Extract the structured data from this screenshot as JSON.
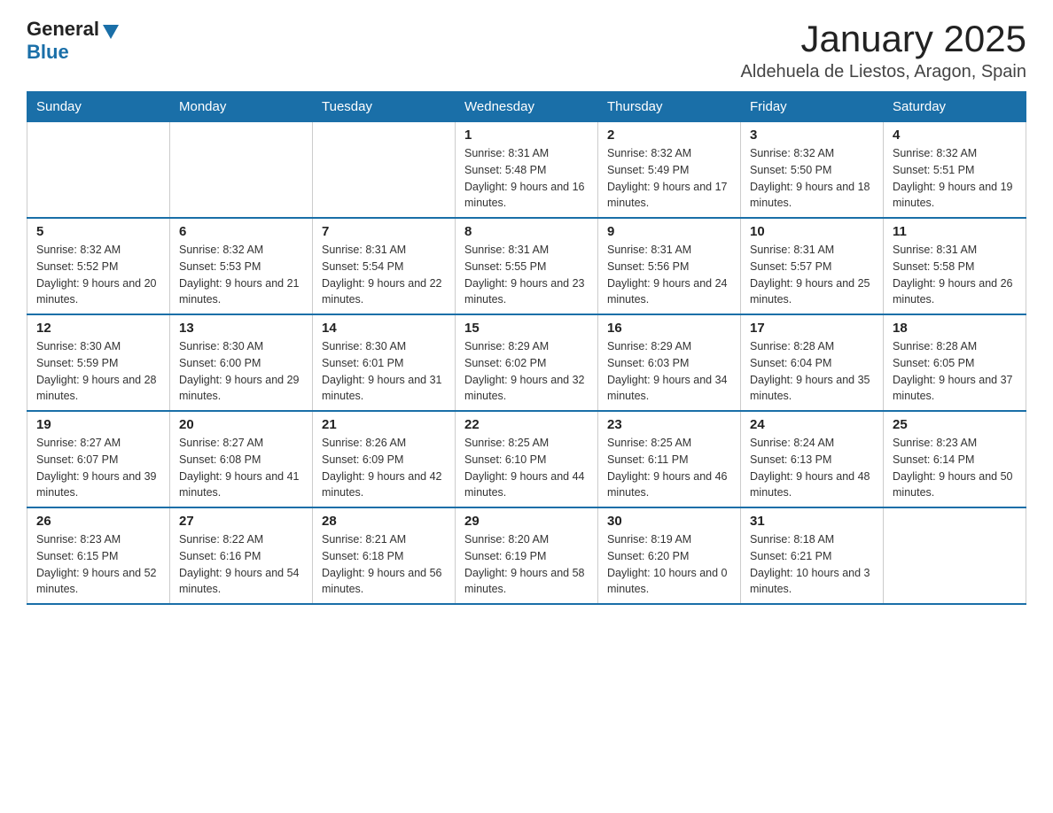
{
  "header": {
    "logo_general": "General",
    "logo_blue": "Blue",
    "month": "January 2025",
    "location": "Aldehuela de Liestos, Aragon, Spain"
  },
  "days_of_week": [
    "Sunday",
    "Monday",
    "Tuesday",
    "Wednesday",
    "Thursday",
    "Friday",
    "Saturday"
  ],
  "weeks": [
    [
      {
        "day": "",
        "info": ""
      },
      {
        "day": "",
        "info": ""
      },
      {
        "day": "",
        "info": ""
      },
      {
        "day": "1",
        "info": "Sunrise: 8:31 AM\nSunset: 5:48 PM\nDaylight: 9 hours and 16 minutes."
      },
      {
        "day": "2",
        "info": "Sunrise: 8:32 AM\nSunset: 5:49 PM\nDaylight: 9 hours and 17 minutes."
      },
      {
        "day": "3",
        "info": "Sunrise: 8:32 AM\nSunset: 5:50 PM\nDaylight: 9 hours and 18 minutes."
      },
      {
        "day": "4",
        "info": "Sunrise: 8:32 AM\nSunset: 5:51 PM\nDaylight: 9 hours and 19 minutes."
      }
    ],
    [
      {
        "day": "5",
        "info": "Sunrise: 8:32 AM\nSunset: 5:52 PM\nDaylight: 9 hours and 20 minutes."
      },
      {
        "day": "6",
        "info": "Sunrise: 8:32 AM\nSunset: 5:53 PM\nDaylight: 9 hours and 21 minutes."
      },
      {
        "day": "7",
        "info": "Sunrise: 8:31 AM\nSunset: 5:54 PM\nDaylight: 9 hours and 22 minutes."
      },
      {
        "day": "8",
        "info": "Sunrise: 8:31 AM\nSunset: 5:55 PM\nDaylight: 9 hours and 23 minutes."
      },
      {
        "day": "9",
        "info": "Sunrise: 8:31 AM\nSunset: 5:56 PM\nDaylight: 9 hours and 24 minutes."
      },
      {
        "day": "10",
        "info": "Sunrise: 8:31 AM\nSunset: 5:57 PM\nDaylight: 9 hours and 25 minutes."
      },
      {
        "day": "11",
        "info": "Sunrise: 8:31 AM\nSunset: 5:58 PM\nDaylight: 9 hours and 26 minutes."
      }
    ],
    [
      {
        "day": "12",
        "info": "Sunrise: 8:30 AM\nSunset: 5:59 PM\nDaylight: 9 hours and 28 minutes."
      },
      {
        "day": "13",
        "info": "Sunrise: 8:30 AM\nSunset: 6:00 PM\nDaylight: 9 hours and 29 minutes."
      },
      {
        "day": "14",
        "info": "Sunrise: 8:30 AM\nSunset: 6:01 PM\nDaylight: 9 hours and 31 minutes."
      },
      {
        "day": "15",
        "info": "Sunrise: 8:29 AM\nSunset: 6:02 PM\nDaylight: 9 hours and 32 minutes."
      },
      {
        "day": "16",
        "info": "Sunrise: 8:29 AM\nSunset: 6:03 PM\nDaylight: 9 hours and 34 minutes."
      },
      {
        "day": "17",
        "info": "Sunrise: 8:28 AM\nSunset: 6:04 PM\nDaylight: 9 hours and 35 minutes."
      },
      {
        "day": "18",
        "info": "Sunrise: 8:28 AM\nSunset: 6:05 PM\nDaylight: 9 hours and 37 minutes."
      }
    ],
    [
      {
        "day": "19",
        "info": "Sunrise: 8:27 AM\nSunset: 6:07 PM\nDaylight: 9 hours and 39 minutes."
      },
      {
        "day": "20",
        "info": "Sunrise: 8:27 AM\nSunset: 6:08 PM\nDaylight: 9 hours and 41 minutes."
      },
      {
        "day": "21",
        "info": "Sunrise: 8:26 AM\nSunset: 6:09 PM\nDaylight: 9 hours and 42 minutes."
      },
      {
        "day": "22",
        "info": "Sunrise: 8:25 AM\nSunset: 6:10 PM\nDaylight: 9 hours and 44 minutes."
      },
      {
        "day": "23",
        "info": "Sunrise: 8:25 AM\nSunset: 6:11 PM\nDaylight: 9 hours and 46 minutes."
      },
      {
        "day": "24",
        "info": "Sunrise: 8:24 AM\nSunset: 6:13 PM\nDaylight: 9 hours and 48 minutes."
      },
      {
        "day": "25",
        "info": "Sunrise: 8:23 AM\nSunset: 6:14 PM\nDaylight: 9 hours and 50 minutes."
      }
    ],
    [
      {
        "day": "26",
        "info": "Sunrise: 8:23 AM\nSunset: 6:15 PM\nDaylight: 9 hours and 52 minutes."
      },
      {
        "day": "27",
        "info": "Sunrise: 8:22 AM\nSunset: 6:16 PM\nDaylight: 9 hours and 54 minutes."
      },
      {
        "day": "28",
        "info": "Sunrise: 8:21 AM\nSunset: 6:18 PM\nDaylight: 9 hours and 56 minutes."
      },
      {
        "day": "29",
        "info": "Sunrise: 8:20 AM\nSunset: 6:19 PM\nDaylight: 9 hours and 58 minutes."
      },
      {
        "day": "30",
        "info": "Sunrise: 8:19 AM\nSunset: 6:20 PM\nDaylight: 10 hours and 0 minutes."
      },
      {
        "day": "31",
        "info": "Sunrise: 8:18 AM\nSunset: 6:21 PM\nDaylight: 10 hours and 3 minutes."
      },
      {
        "day": "",
        "info": ""
      }
    ]
  ]
}
